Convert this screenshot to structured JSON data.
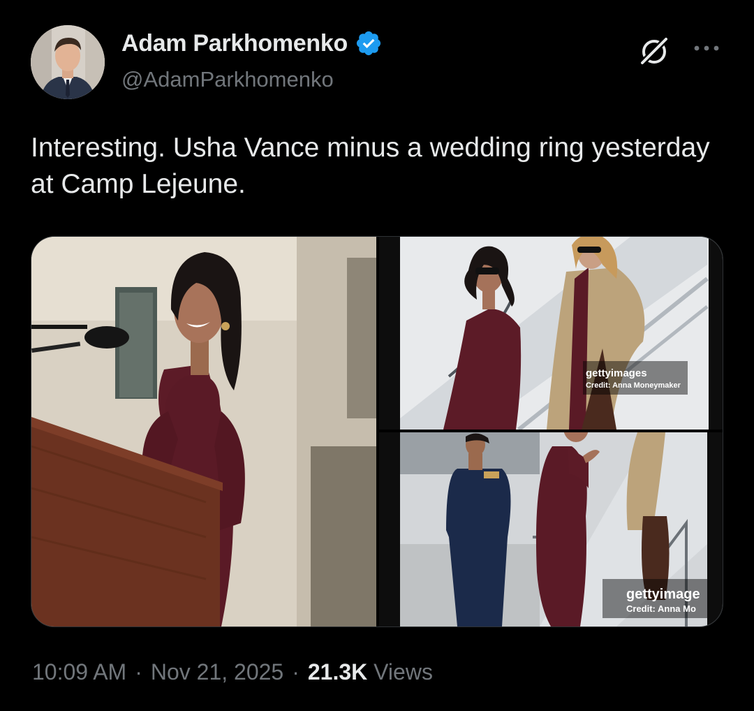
{
  "author": {
    "display_name": "Adam Parkhomenko",
    "handle": "@AdamParkhomenko",
    "verified": true
  },
  "icons": [
    "verified-badge-icon",
    "grok-icon",
    "more-icon"
  ],
  "tweet": {
    "text": "Interesting. Usha Vance minus a wedding ring yesterday at Camp Lejeune."
  },
  "media": {
    "image_2": {
      "watermark": "gettyimages",
      "credit": "Credit: Anna Moneymaker"
    },
    "image_3": {
      "watermark": "gettyimage",
      "credit": "Credit: Anna Mo"
    }
  },
  "meta": {
    "time": "10:09 AM",
    "separator": "·",
    "date": "Nov 21, 2025",
    "views_count": "21.3K",
    "views_label": "Views"
  },
  "colors": {
    "background": "#000000",
    "primary_text": "#e7e9ea",
    "secondary_text": "#71767b",
    "verified_blue": "#1d9bf0",
    "border": "#2f3336"
  }
}
